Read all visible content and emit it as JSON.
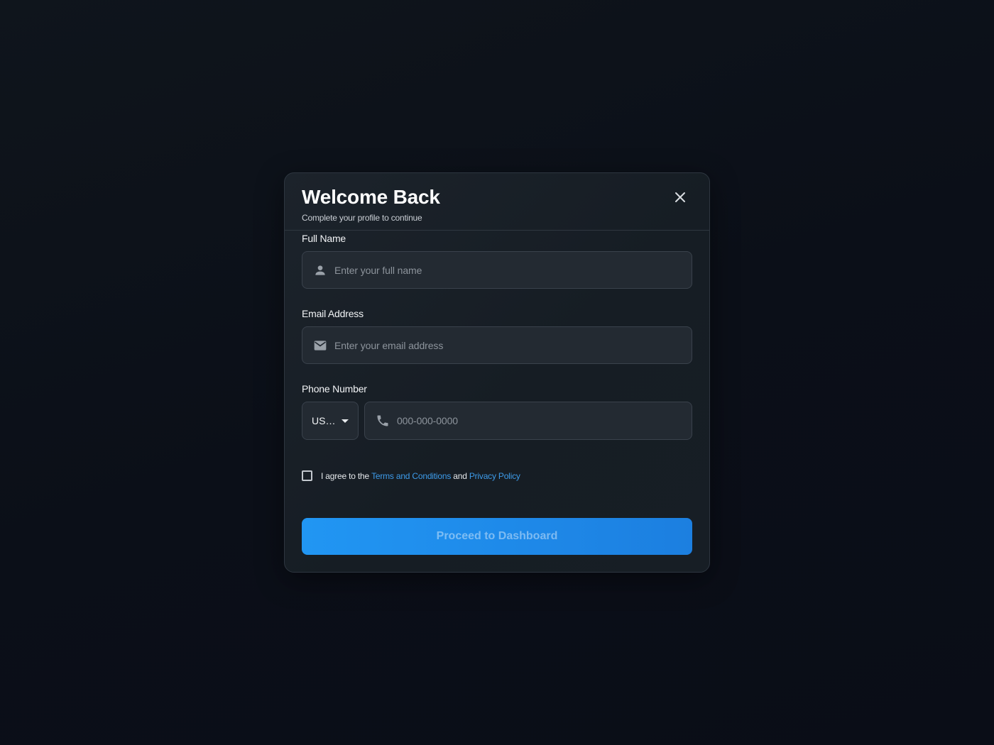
{
  "modal": {
    "title": "Welcome Back",
    "subtitle": "Complete your profile to continue",
    "close_icon": "close-icon"
  },
  "form": {
    "full_name": {
      "label": "Full Name",
      "placeholder": "Enter your full name",
      "value": "",
      "icon": "person-icon"
    },
    "email": {
      "label": "Email Address",
      "placeholder": "Enter your email address",
      "value": "",
      "icon": "mail-icon"
    },
    "phone": {
      "label": "Phone Number",
      "country_code": "US…",
      "placeholder": "000-000-0000",
      "value": "",
      "icon": "phone-icon"
    },
    "terms": {
      "prefix": "I agree to the ",
      "terms_link": "Terms and Conditions",
      "conjunction": " and ",
      "privacy_link": "Privacy Policy",
      "checked": false
    },
    "submit_label": "Proceed to Dashboard"
  },
  "colors": {
    "accent": "#2196f3",
    "link": "#3d9be9",
    "background": "#0b0f18",
    "modal_bg": "#1a2128"
  }
}
